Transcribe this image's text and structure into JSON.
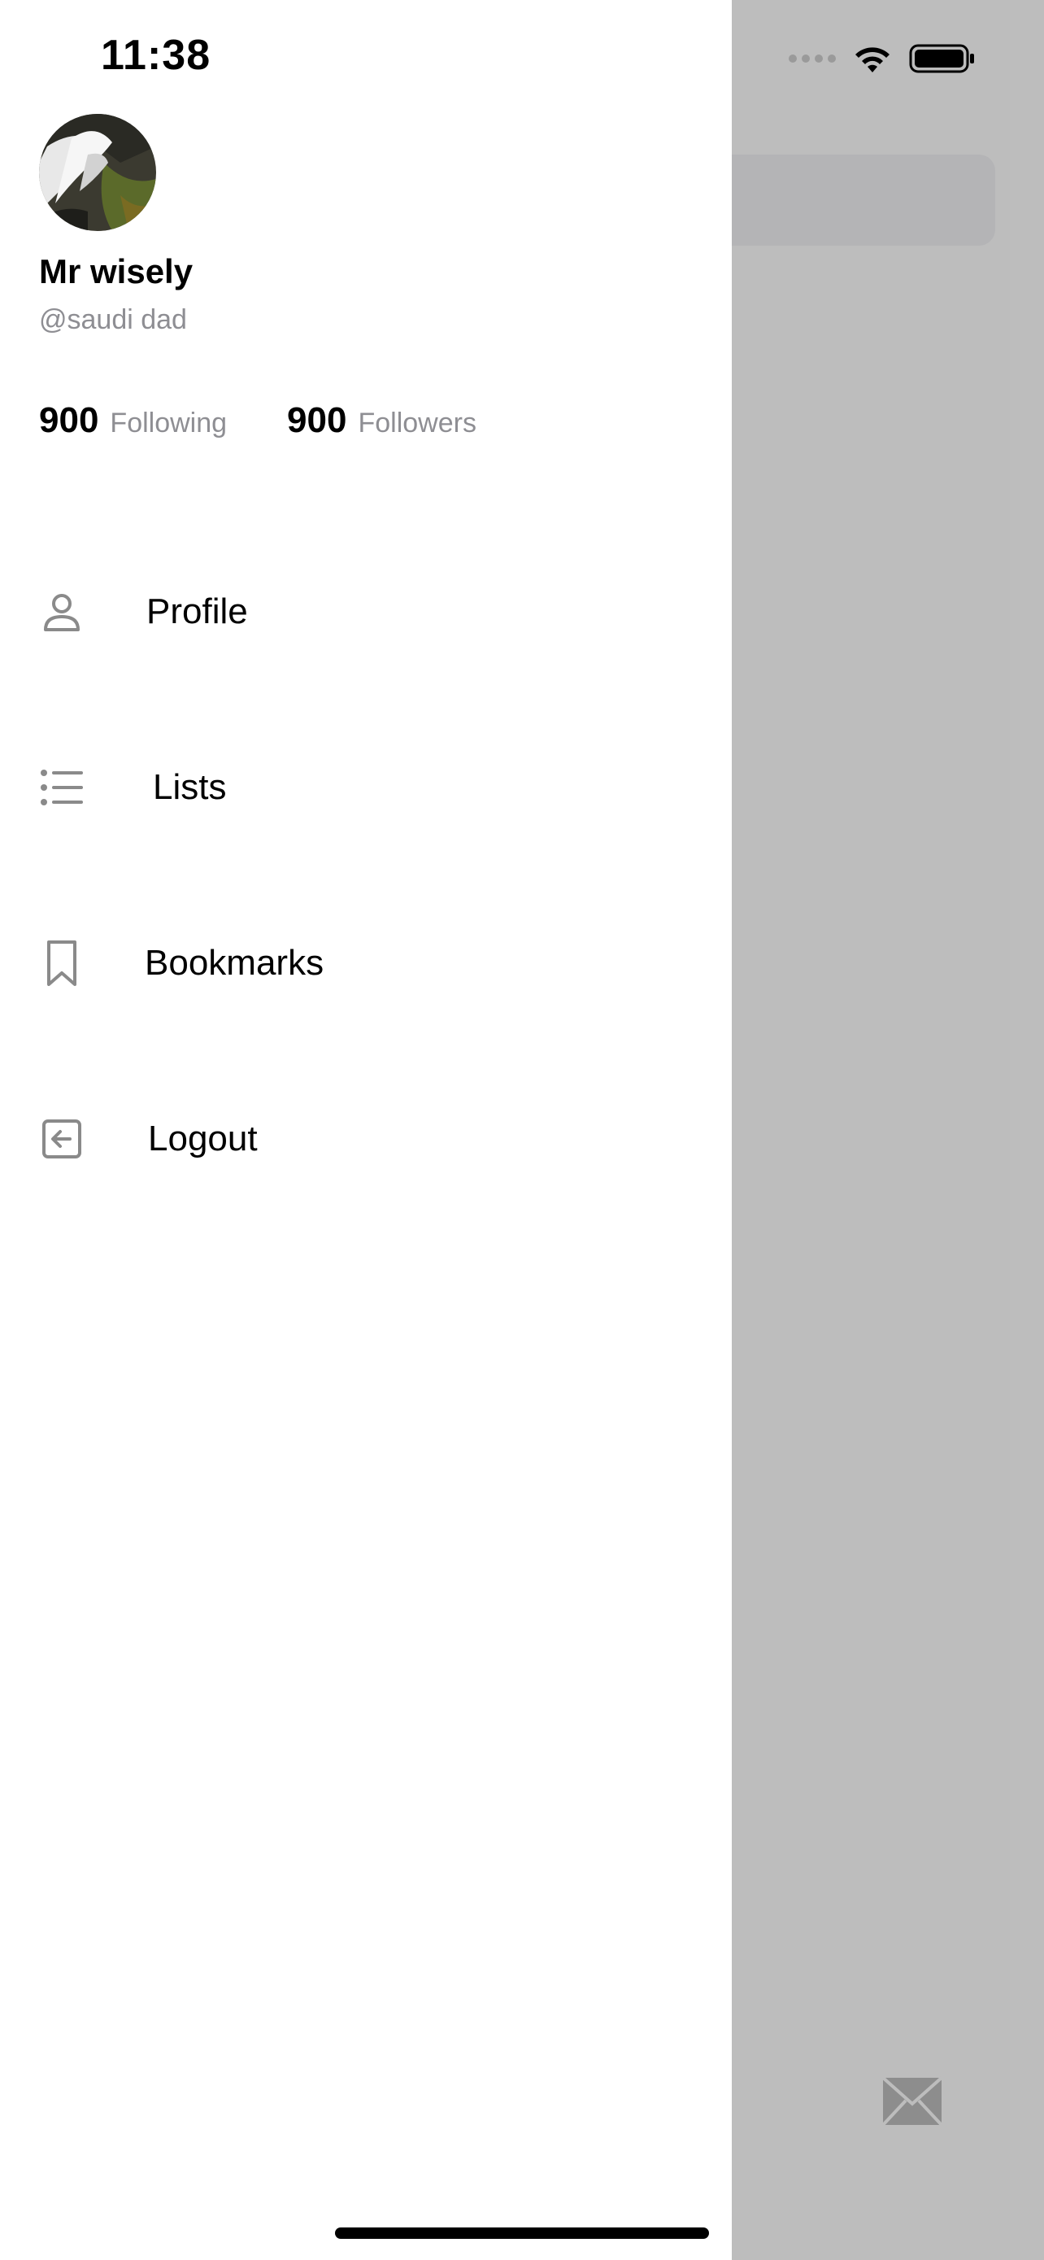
{
  "status_bar": {
    "time": "11:38"
  },
  "user": {
    "name": "Mr wisely",
    "handle": "@saudi dad",
    "following_count": "900",
    "following_label": "Following",
    "followers_count": "900",
    "followers_label": "Followers"
  },
  "menu": {
    "items": [
      {
        "label": "Profile",
        "icon": "person-icon"
      },
      {
        "label": "Lists",
        "icon": "list-icon"
      },
      {
        "label": "Bookmarks",
        "icon": "bookmark-icon"
      },
      {
        "label": "Logout",
        "icon": "logout-icon"
      }
    ]
  },
  "colors": {
    "accent_gray": "#8e8e93",
    "backdrop": "#bdbdbd",
    "icon_gray": "#8a8a8a"
  }
}
